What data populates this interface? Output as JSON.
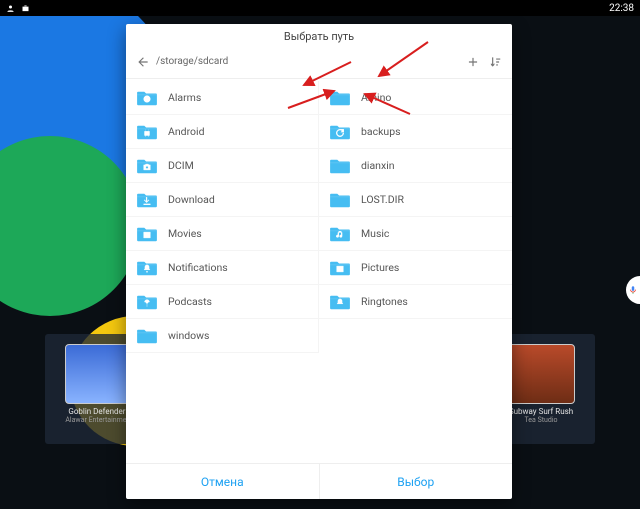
{
  "statusbar": {
    "clock": "22:38"
  },
  "apps": {
    "left": {
      "title": "Goblin Defenders",
      "subtitle": "Alawar Entertainment"
    },
    "right": {
      "title": "Subway Surf Rush",
      "subtitle": "Tea Studio"
    }
  },
  "picker": {
    "title": "Выбрать путь",
    "path": "/storage/sdcard",
    "actions": {
      "cancel": "Отмена",
      "choose": "Выбор"
    },
    "folders_left": [
      {
        "name": "Alarms",
        "glyph": "alarm"
      },
      {
        "name": "Android",
        "glyph": "android"
      },
      {
        "name": "DCIM",
        "glyph": "camera"
      },
      {
        "name": "Download",
        "glyph": "download"
      },
      {
        "name": "Movies",
        "glyph": "movie"
      },
      {
        "name": "Notifications",
        "glyph": "bell"
      },
      {
        "name": "Podcasts",
        "glyph": "podcast"
      },
      {
        "name": "windows",
        "glyph": ""
      }
    ],
    "folders_right": [
      {
        "name": "Amino",
        "glyph": ""
      },
      {
        "name": "backups",
        "glyph": "backup"
      },
      {
        "name": "dianxin",
        "glyph": ""
      },
      {
        "name": "LOST.DIR",
        "glyph": ""
      },
      {
        "name": "Music",
        "glyph": "music"
      },
      {
        "name": "Pictures",
        "glyph": "image"
      },
      {
        "name": "Ringtones",
        "glyph": "ringtone"
      }
    ]
  },
  "colors": {
    "folder": "#46bdf2",
    "accent": "#1da1f2",
    "arrow": "#d81e1e"
  }
}
